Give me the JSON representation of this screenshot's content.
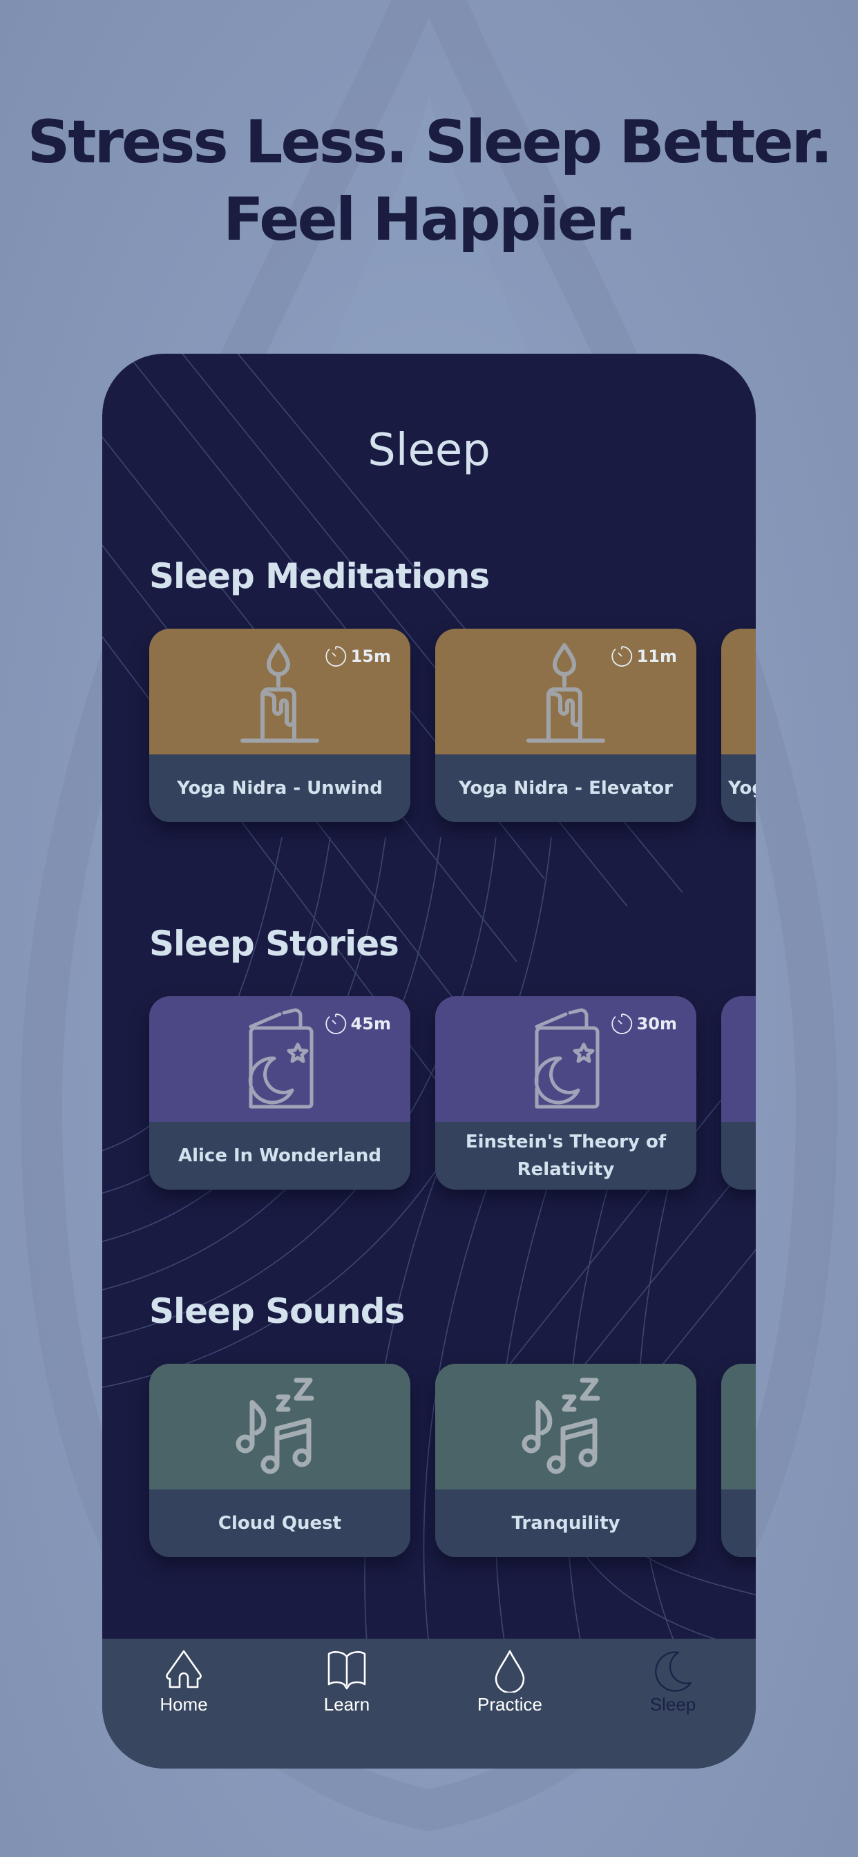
{
  "headline": {
    "line1": "Stress Less. Sleep Better.",
    "line2": "Feel Happier."
  },
  "screen": {
    "title": "Sleep"
  },
  "sections": [
    {
      "title": "Sleep Meditations",
      "icon": "candle-icon",
      "color": "#8e7148",
      "cards": [
        {
          "title": "Yoga Nidra - Unwind",
          "duration": "15m"
        },
        {
          "title": "Yoga Nidra - Elevator",
          "duration": "11m"
        },
        {
          "title": "Yoga Nidra",
          "duration": ""
        }
      ]
    },
    {
      "title": "Sleep Stories",
      "icon": "bedtime-book-icon",
      "color": "#4c4886",
      "cards": [
        {
          "title": "Alice In Wonderland",
          "duration": "45m"
        },
        {
          "title": "Einstein's Theory of Relativity",
          "duration": "30m"
        },
        {
          "title": "",
          "duration": ""
        }
      ]
    },
    {
      "title": "Sleep Sounds",
      "icon": "music-notes-zzz-icon",
      "color": "#4b6468",
      "cards": [
        {
          "title": "Cloud Quest",
          "duration": ""
        },
        {
          "title": "Tranquility",
          "duration": ""
        },
        {
          "title": "",
          "duration": ""
        }
      ]
    }
  ],
  "tabbar": {
    "items": [
      {
        "label": "Home",
        "icon": "home-icon",
        "active": false
      },
      {
        "label": "Learn",
        "icon": "book-icon",
        "active": false
      },
      {
        "label": "Practice",
        "icon": "drop-icon",
        "active": false
      },
      {
        "label": "Sleep",
        "icon": "moon-icon",
        "active": true
      }
    ]
  },
  "colors": {
    "background": "#8a9bbd",
    "headline": "#1a1c40",
    "phone_bg": "#191b42",
    "card_bottom": "#34425e",
    "tabbar": "#38465f",
    "text_light": "#d4e2ee"
  }
}
